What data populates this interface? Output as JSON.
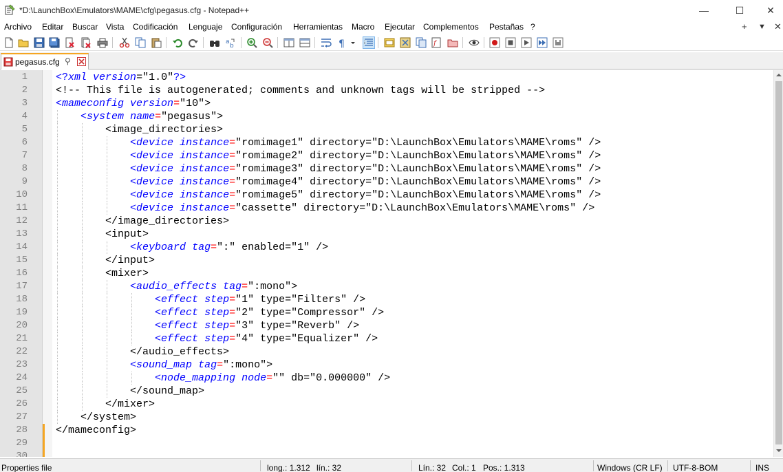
{
  "window": {
    "title": "*D:\\LaunchBox\\Emulators\\MAME\\cfg\\pegasus.cfg - Notepad++",
    "minimize_glyph": "—",
    "maximize_glyph": "☐",
    "close_glyph": "✕"
  },
  "menu": {
    "items": [
      "Archivo",
      "Editar",
      "Buscar",
      "Vista",
      "Codificación",
      "Lenguaje",
      "Configuración",
      "Herramientas",
      "Macro",
      "Ejecutar",
      "Complementos",
      "Pestañas",
      "?"
    ],
    "right": [
      "+",
      "▼",
      "✕"
    ]
  },
  "tab": {
    "label": "pegasus.cfg",
    "pin_glyph": "⚲"
  },
  "editor": {
    "line_numbers": [
      "1",
      "2",
      "3",
      "4",
      "5",
      "6",
      "7",
      "8",
      "9",
      "10",
      "11",
      "12",
      "13",
      "14",
      "15",
      "16",
      "17",
      "18",
      "19",
      "20",
      "21",
      "22",
      "23",
      "24",
      "25",
      "26",
      "27",
      "28",
      "29",
      "30"
    ],
    "lines": [
      [
        [
          "t-tag",
          "<?"
        ],
        [
          "t-name",
          "xml"
        ],
        [
          "t-txt",
          " "
        ],
        [
          "t-attr",
          "version"
        ],
        [
          "t-eq",
          "="
        ],
        [
          "t-str",
          "\"1.0\""
        ],
        [
          "t-tag",
          "?>"
        ]
      ],
      [
        [
          "t-com",
          "<!-- This file is autogenerated; comments and unknown tags will be stripped -->"
        ]
      ],
      [
        [
          "t-tag",
          "<"
        ],
        [
          "t-name",
          "mameconfig"
        ],
        [
          "t-txt",
          " "
        ],
        [
          "t-attr",
          "version"
        ],
        [
          "t-red",
          "="
        ],
        [
          "t-str",
          "\"10\""
        ],
        [
          "t-txt",
          ">"
        ]
      ],
      [
        [
          "t-txt",
          "    "
        ],
        [
          "t-tag",
          "<"
        ],
        [
          "t-name",
          "system"
        ],
        [
          "t-txt",
          " "
        ],
        [
          "t-attr",
          "name"
        ],
        [
          "t-red",
          "="
        ],
        [
          "t-str",
          "\"pegasus\""
        ],
        [
          "t-txt",
          ">"
        ]
      ],
      [
        [
          "t-txt",
          "        <image_directories>"
        ]
      ],
      [
        [
          "t-txt",
          "            "
        ],
        [
          "t-tag",
          "<"
        ],
        [
          "t-name",
          "device"
        ],
        [
          "t-txt",
          " "
        ],
        [
          "t-attr",
          "instance"
        ],
        [
          "t-red",
          "="
        ],
        [
          "t-str",
          "\"romimage1\" directory=\"D:\\LaunchBox\\Emulators\\MAME\\roms\" />"
        ]
      ],
      [
        [
          "t-txt",
          "            "
        ],
        [
          "t-tag",
          "<"
        ],
        [
          "t-name",
          "device"
        ],
        [
          "t-txt",
          " "
        ],
        [
          "t-attr",
          "instance"
        ],
        [
          "t-red",
          "="
        ],
        [
          "t-str",
          "\"romimage2\" directory=\"D:\\LaunchBox\\Emulators\\MAME\\roms\" />"
        ]
      ],
      [
        [
          "t-txt",
          "            "
        ],
        [
          "t-tag",
          "<"
        ],
        [
          "t-name",
          "device"
        ],
        [
          "t-txt",
          " "
        ],
        [
          "t-attr",
          "instance"
        ],
        [
          "t-red",
          "="
        ],
        [
          "t-str",
          "\"romimage3\" directory=\"D:\\LaunchBox\\Emulators\\MAME\\roms\" />"
        ]
      ],
      [
        [
          "t-txt",
          "            "
        ],
        [
          "t-tag",
          "<"
        ],
        [
          "t-name",
          "device"
        ],
        [
          "t-txt",
          " "
        ],
        [
          "t-attr",
          "instance"
        ],
        [
          "t-red",
          "="
        ],
        [
          "t-str",
          "\"romimage4\" directory=\"D:\\LaunchBox\\Emulators\\MAME\\roms\" />"
        ]
      ],
      [
        [
          "t-txt",
          "            "
        ],
        [
          "t-tag",
          "<"
        ],
        [
          "t-name",
          "device"
        ],
        [
          "t-txt",
          " "
        ],
        [
          "t-attr",
          "instance"
        ],
        [
          "t-red",
          "="
        ],
        [
          "t-str",
          "\"romimage5\" directory=\"D:\\LaunchBox\\Emulators\\MAME\\roms\" />"
        ]
      ],
      [
        [
          "t-txt",
          "            "
        ],
        [
          "t-tag",
          "<"
        ],
        [
          "t-name",
          "device"
        ],
        [
          "t-txt",
          " "
        ],
        [
          "t-attr",
          "instance"
        ],
        [
          "t-red",
          "="
        ],
        [
          "t-str",
          "\"cassette\" directory=\"D:\\LaunchBox\\Emulators\\MAME\\roms\" />"
        ]
      ],
      [
        [
          "t-txt",
          "        </image_directories>"
        ]
      ],
      [
        [
          "t-txt",
          "        <input>"
        ]
      ],
      [
        [
          "t-txt",
          "            "
        ],
        [
          "t-tag",
          "<"
        ],
        [
          "t-name",
          "keyboard"
        ],
        [
          "t-txt",
          " "
        ],
        [
          "t-attr",
          "tag"
        ],
        [
          "t-red",
          "="
        ],
        [
          "t-str",
          "\":\" enabled=\"1\" />"
        ]
      ],
      [
        [
          "t-txt",
          "        </input>"
        ]
      ],
      [
        [
          "t-txt",
          "        <mixer>"
        ]
      ],
      [
        [
          "t-txt",
          "            "
        ],
        [
          "t-tag",
          "<"
        ],
        [
          "t-name",
          "audio_effects"
        ],
        [
          "t-txt",
          " "
        ],
        [
          "t-attr",
          "tag"
        ],
        [
          "t-red",
          "="
        ],
        [
          "t-str",
          "\":mono\">"
        ]
      ],
      [
        [
          "t-txt",
          "                "
        ],
        [
          "t-tag",
          "<"
        ],
        [
          "t-name",
          "effect"
        ],
        [
          "t-txt",
          " "
        ],
        [
          "t-attr",
          "step"
        ],
        [
          "t-red",
          "="
        ],
        [
          "t-str",
          "\"1\" type=\"Filters\" />"
        ]
      ],
      [
        [
          "t-txt",
          "                "
        ],
        [
          "t-tag",
          "<"
        ],
        [
          "t-name",
          "effect"
        ],
        [
          "t-txt",
          " "
        ],
        [
          "t-attr",
          "step"
        ],
        [
          "t-red",
          "="
        ],
        [
          "t-str",
          "\"2\" type=\"Compressor\" />"
        ]
      ],
      [
        [
          "t-txt",
          "                "
        ],
        [
          "t-tag",
          "<"
        ],
        [
          "t-name",
          "effect"
        ],
        [
          "t-txt",
          " "
        ],
        [
          "t-attr",
          "step"
        ],
        [
          "t-red",
          "="
        ],
        [
          "t-str",
          "\"3\" type=\"Reverb\" />"
        ]
      ],
      [
        [
          "t-txt",
          "                "
        ],
        [
          "t-tag",
          "<"
        ],
        [
          "t-name",
          "effect"
        ],
        [
          "t-txt",
          " "
        ],
        [
          "t-attr",
          "step"
        ],
        [
          "t-red",
          "="
        ],
        [
          "t-str",
          "\"4\" type=\"Equalizer\" />"
        ]
      ],
      [
        [
          "t-txt",
          "            </audio_effects>"
        ]
      ],
      [
        [
          "t-txt",
          "            "
        ],
        [
          "t-tag",
          "<"
        ],
        [
          "t-name",
          "sound_map"
        ],
        [
          "t-txt",
          " "
        ],
        [
          "t-attr",
          "tag"
        ],
        [
          "t-red",
          "="
        ],
        [
          "t-str",
          "\":mono\">"
        ]
      ],
      [
        [
          "t-txt",
          "                "
        ],
        [
          "t-tag",
          "<"
        ],
        [
          "t-name",
          "node_mapping"
        ],
        [
          "t-txt",
          " "
        ],
        [
          "t-attr",
          "node"
        ],
        [
          "t-red",
          "="
        ],
        [
          "t-str",
          "\"\" db=\"0.000000\" />"
        ]
      ],
      [
        [
          "t-txt",
          "            </sound_map>"
        ]
      ],
      [
        [
          "t-txt",
          "        </mixer>"
        ]
      ],
      [
        [
          "t-txt",
          "    </system>"
        ]
      ],
      [
        [
          "t-txt",
          "</mameconfig>"
        ]
      ],
      [
        [
          "t-txt",
          ""
        ]
      ],
      [
        [
          "t-txt",
          ""
        ]
      ]
    ],
    "changed_lines": [
      27,
      28,
      29
    ]
  },
  "status": {
    "file_type": "Properties file",
    "length": "long.: 1.312",
    "lines": "lín.: 32",
    "cursor_line": "Lín.: 32",
    "cursor_col": "Col.: 1",
    "cursor_pos": "Pos.: 1.313",
    "eol": "Windows (CR LF)",
    "encoding": "UTF-8-BOM",
    "mode": "INS"
  }
}
